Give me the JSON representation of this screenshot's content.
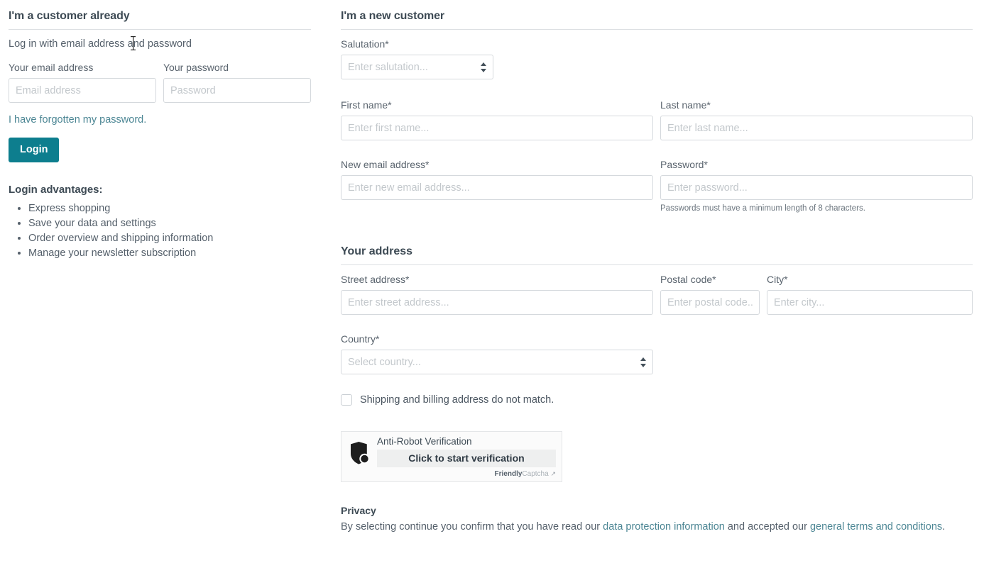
{
  "left": {
    "title": "I'm a customer already",
    "intro": "Log in with email address and password",
    "email": {
      "label": "Your email address",
      "placeholder": "Email address",
      "value": ""
    },
    "password": {
      "label": "Your password",
      "placeholder": "Password",
      "value": ""
    },
    "forgot_link": "I have forgotten my password.",
    "login_button": "Login",
    "advantages_title": "Login advantages:",
    "advantages": [
      "Express shopping",
      "Save your data and settings",
      "Order overview and shipping information",
      "Manage your newsletter subscription"
    ]
  },
  "right": {
    "title": "I'm a new customer",
    "salutation": {
      "label": "Salutation*",
      "placeholder": "Enter salutation...",
      "value": ""
    },
    "first_name": {
      "label": "First name*",
      "placeholder": "Enter first name...",
      "value": ""
    },
    "last_name": {
      "label": "Last name*",
      "placeholder": "Enter last name...",
      "value": ""
    },
    "new_email": {
      "label": "New email address*",
      "placeholder": "Enter new email address...",
      "value": ""
    },
    "new_password": {
      "label": "Password*",
      "placeholder": "Enter password...",
      "value": "",
      "help": "Passwords must have a minimum length of 8 characters."
    },
    "address": {
      "title": "Your address",
      "street": {
        "label": "Street address*",
        "placeholder": "Enter street address...",
        "value": ""
      },
      "postal": {
        "label": "Postal code*",
        "placeholder": "Enter postal code...",
        "value": ""
      },
      "city": {
        "label": "City*",
        "placeholder": "Enter city...",
        "value": ""
      },
      "country": {
        "label": "Country*",
        "placeholder": "Select country...",
        "value": ""
      },
      "different_shipping_label": "Shipping and billing address do not match.",
      "different_shipping_checked": false
    },
    "captcha": {
      "icon": "shield-icon",
      "title": "Anti-Robot Verification",
      "button": "Click to start verification",
      "brand_strong": "Friendly",
      "brand_light": "Captcha",
      "external_arrow": "↗"
    },
    "privacy": {
      "title": "Privacy",
      "text_before": "By selecting continue you confirm that you have read our ",
      "link_data_protection": "data protection information",
      "text_middle": " and accepted our ",
      "link_terms": "general terms and conditions",
      "text_after": "."
    }
  },
  "colors": {
    "accent": "#0d7e8e",
    "link": "#4c8694",
    "heading": "#3d4a54",
    "text": "#55606b",
    "border": "#d5d9dd",
    "placeholder": "#c3c8cc"
  }
}
